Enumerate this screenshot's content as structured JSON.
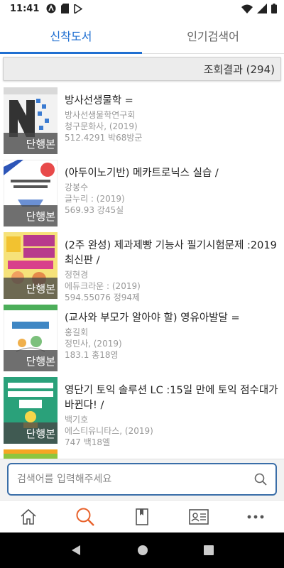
{
  "status_bar": {
    "time": "11:41"
  },
  "tabs": [
    {
      "label": "신착도서",
      "active": true
    },
    {
      "label": "인기검색어",
      "active": false
    }
  ],
  "results": {
    "label": "조회결과 (294)"
  },
  "books": [
    {
      "title": "방사선생물학 =",
      "author": "방사선생물학연구회",
      "publisher": "청구문화사, (2019)",
      "call_number": "512.4291 박68방군",
      "badge": "단행본"
    },
    {
      "title": "(아두이노기반) 메카트로닉스 실습 /",
      "author": "강봉수",
      "publisher": "글누리 : (2019)",
      "call_number": "569.93 강45실",
      "badge": "단행본"
    },
    {
      "title": "(2주 완성) 제과제빵 기능사 필기시험문제 :2019 최신판 /",
      "author": "정현경",
      "publisher": "에듀크라운 : (2019)",
      "call_number": "594.55076 정94제",
      "badge": "단행본"
    },
    {
      "title": "(교사와 부모가 알아야 할) 영유아발달 =",
      "author": "홍길회",
      "publisher": "정민사, (2019)",
      "call_number": "183.1 홍18영",
      "badge": "단행본"
    },
    {
      "title": "영단기 토익 솔루션 LC :15일 만에 토익 점수대가 바뀐다! /",
      "author": "백기호",
      "publisher": "에스티유니타스, (2019)",
      "call_number": "747 백18엘",
      "badge": "단행본"
    }
  ],
  "search": {
    "placeholder": "검색어를 입력해주세요"
  },
  "bottom_nav": [
    {
      "icon": "home-icon",
      "active": false
    },
    {
      "icon": "search-icon",
      "active": true
    },
    {
      "icon": "book-icon",
      "active": false
    },
    {
      "icon": "id-card-icon",
      "active": false
    },
    {
      "icon": "more-icon",
      "active": false
    }
  ],
  "colors": {
    "accent": "#1f6fd1",
    "active_nav": "#e8622c",
    "search_border": "#3a6ea8"
  }
}
